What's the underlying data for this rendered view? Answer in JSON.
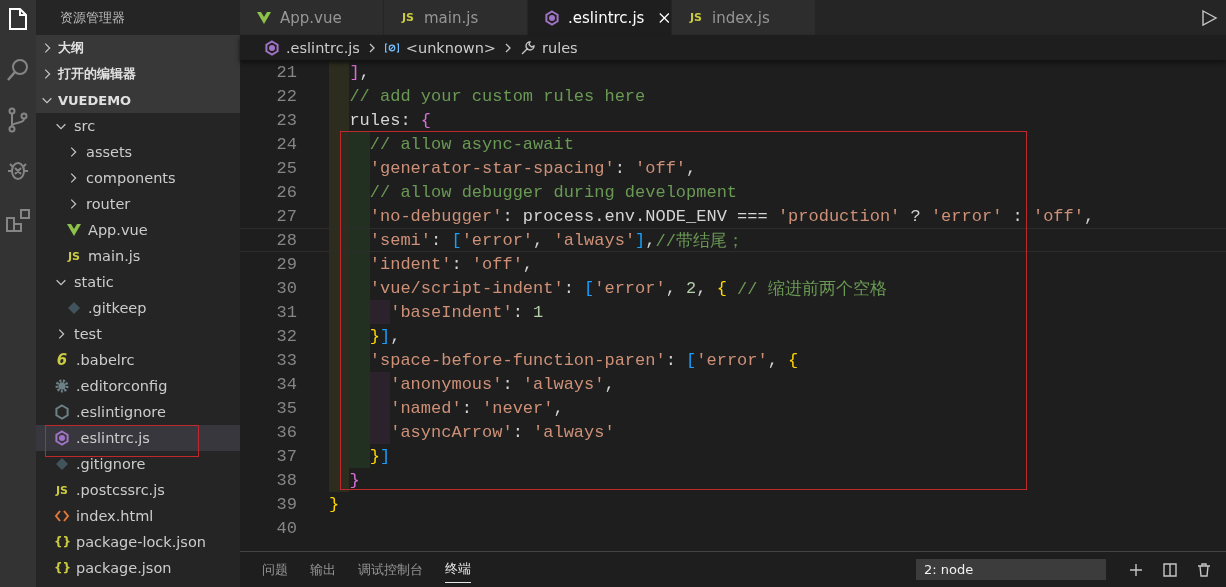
{
  "activity_bar": [
    {
      "kind": "files",
      "selected": true
    },
    {
      "kind": "search",
      "selected": false
    },
    {
      "kind": "scm",
      "selected": false
    },
    {
      "kind": "debug",
      "selected": false
    },
    {
      "kind": "extensions",
      "selected": false
    }
  ],
  "sidebar": {
    "title": "资源管理器",
    "sections": [
      {
        "label": "大纲",
        "expanded": false
      },
      {
        "label": "打开的编辑器",
        "expanded": false
      },
      {
        "label": "VUEDEMO",
        "expanded": true,
        "children": [
          {
            "label": "src",
            "kind": "folder",
            "expanded": true,
            "selected": false,
            "children": [
              {
                "label": "assets",
                "kind": "folder",
                "expanded": false,
                "selected": false
              },
              {
                "label": "components",
                "kind": "folder",
                "expanded": false,
                "selected": false
              },
              {
                "label": "router",
                "kind": "folder",
                "expanded": false,
                "selected": false
              },
              {
                "label": "App.vue",
                "kind": "vue",
                "selected": false
              },
              {
                "label": "main.js",
                "kind": "js",
                "icon_label": "JS",
                "selected": false
              }
            ]
          },
          {
            "label": "static",
            "kind": "folder",
            "expanded": true,
            "selected": false,
            "children": [
              {
                "label": ".gitkeep",
                "kind": "git",
                "selected": false
              }
            ]
          },
          {
            "label": "test",
            "kind": "folder",
            "expanded": false,
            "selected": false
          },
          {
            "label": ".babelrc",
            "kind": "babel",
            "icon_label": "6",
            "selected": false
          },
          {
            "label": ".editorconfig",
            "kind": "gear",
            "selected": false
          },
          {
            "label": ".eslintignore",
            "kind": "eslintignore",
            "selected": false
          },
          {
            "label": ".eslintrc.js",
            "kind": "eslint",
            "selected": true
          },
          {
            "label": ".gitignore",
            "kind": "git",
            "selected": false
          },
          {
            "label": ".postcssrc.js",
            "kind": "js",
            "icon_label": "JS",
            "selected": false
          },
          {
            "label": "index.html",
            "kind": "html",
            "selected": false
          },
          {
            "label": "package-lock.json",
            "kind": "json",
            "icon_label": "{}",
            "selected": false
          },
          {
            "label": "package.json",
            "kind": "json",
            "icon_label": "{}",
            "selected": false
          }
        ]
      }
    ]
  },
  "tabs": [
    {
      "label": "App.vue",
      "kind": "vue",
      "selected": false
    },
    {
      "label": "main.js",
      "kind": "js",
      "icon_label": "JS",
      "selected": false
    },
    {
      "label": ".eslintrc.js",
      "kind": "eslint",
      "selected": true
    },
    {
      "label": "index.js",
      "kind": "js",
      "icon_label": "JS",
      "selected": false
    }
  ],
  "breadcrumb": [
    {
      "label": ".eslintrc.js",
      "kind": "eslint"
    },
    {
      "label": "<unknown>",
      "kind": "variable"
    },
    {
      "label": "rules",
      "kind": "wrench"
    }
  ],
  "code_lines": [
    {
      "number": "21",
      "current": false,
      "tokens": [
        {
          "kind": "bracket2",
          "text": "  ]"
        },
        {
          "kind": "plain",
          "text": ","
        }
      ]
    },
    {
      "number": "22",
      "current": false,
      "tokens": [
        {
          "kind": "comment",
          "text": "  // add your custom rules here"
        }
      ]
    },
    {
      "number": "23",
      "current": false,
      "tokens": [
        {
          "kind": "plain",
          "text": "  rules: "
        },
        {
          "kind": "bracket2",
          "text": "{"
        }
      ]
    },
    {
      "number": "24",
      "current": false,
      "tokens": [
        {
          "kind": "comment",
          "text": "    // allow async-await"
        }
      ]
    },
    {
      "number": "25",
      "current": false,
      "tokens": [
        {
          "kind": "string",
          "text": "    'generator-star-spacing'"
        },
        {
          "kind": "plain",
          "text": ": "
        },
        {
          "kind": "string",
          "text": "'off'"
        },
        {
          "kind": "plain",
          "text": ","
        }
      ]
    },
    {
      "number": "26",
      "current": false,
      "tokens": [
        {
          "kind": "comment",
          "text": "    // allow debugger during development"
        }
      ]
    },
    {
      "number": "27",
      "current": false,
      "tokens": [
        {
          "kind": "string",
          "text": "    'no-debugger'"
        },
        {
          "kind": "plain",
          "text": ": process.env.NODE_ENV === "
        },
        {
          "kind": "string",
          "text": "'production'"
        },
        {
          "kind": "plain",
          "text": " ? "
        },
        {
          "kind": "string",
          "text": "'error'"
        },
        {
          "kind": "plain",
          "text": " : "
        },
        {
          "kind": "string",
          "text": "'off'"
        },
        {
          "kind": "plain",
          "text": ","
        }
      ]
    },
    {
      "number": "28",
      "current": true,
      "tokens": [
        {
          "kind": "string",
          "text": "    'semi'"
        },
        {
          "kind": "plain",
          "text": ": "
        },
        {
          "kind": "bracket3",
          "text": "["
        },
        {
          "kind": "string",
          "text": "'error'"
        },
        {
          "kind": "plain",
          "text": ", "
        },
        {
          "kind": "string",
          "text": "'always'"
        },
        {
          "kind": "bracket3",
          "text": "]"
        },
        {
          "kind": "plain",
          "text": ","
        },
        {
          "kind": "comment",
          "text": "//带结尾；"
        }
      ]
    },
    {
      "number": "29",
      "current": false,
      "tokens": [
        {
          "kind": "string",
          "text": "    'indent'"
        },
        {
          "kind": "plain",
          "text": ": "
        },
        {
          "kind": "string",
          "text": "'off'"
        },
        {
          "kind": "plain",
          "text": ","
        }
      ]
    },
    {
      "number": "30",
      "current": false,
      "tokens": [
        {
          "kind": "string",
          "text": "    'vue/script-indent'"
        },
        {
          "kind": "plain",
          "text": ": "
        },
        {
          "kind": "bracket3",
          "text": "["
        },
        {
          "kind": "string",
          "text": "'error'"
        },
        {
          "kind": "plain",
          "text": ", "
        },
        {
          "kind": "number",
          "text": "2"
        },
        {
          "kind": "plain",
          "text": ", "
        },
        {
          "kind": "bracket1",
          "text": "{"
        },
        {
          "kind": "comment",
          "text": " // 缩进前两个空格"
        }
      ]
    },
    {
      "number": "31",
      "current": false,
      "tokens": [
        {
          "kind": "string",
          "text": "      'baseIndent'"
        },
        {
          "kind": "plain",
          "text": ": "
        },
        {
          "kind": "number",
          "text": "1"
        }
      ]
    },
    {
      "number": "32",
      "current": false,
      "tokens": [
        {
          "kind": "bracket1",
          "text": "    }"
        },
        {
          "kind": "bracket3",
          "text": "]"
        },
        {
          "kind": "plain",
          "text": ","
        }
      ]
    },
    {
      "number": "33",
      "current": false,
      "tokens": [
        {
          "kind": "string",
          "text": "    'space-before-function-paren'"
        },
        {
          "kind": "plain",
          "text": ": "
        },
        {
          "kind": "bracket3",
          "text": "["
        },
        {
          "kind": "string",
          "text": "'error'"
        },
        {
          "kind": "plain",
          "text": ", "
        },
        {
          "kind": "bracket1",
          "text": "{"
        }
      ]
    },
    {
      "number": "34",
      "current": false,
      "tokens": [
        {
          "kind": "string",
          "text": "      'anonymous'"
        },
        {
          "kind": "plain",
          "text": ": "
        },
        {
          "kind": "string",
          "text": "'always'"
        },
        {
          "kind": "plain",
          "text": ","
        }
      ]
    },
    {
      "number": "35",
      "current": false,
      "tokens": [
        {
          "kind": "string",
          "text": "      'named'"
        },
        {
          "kind": "plain",
          "text": ": "
        },
        {
          "kind": "string",
          "text": "'never'"
        },
        {
          "kind": "plain",
          "text": ","
        }
      ]
    },
    {
      "number": "36",
      "current": false,
      "tokens": [
        {
          "kind": "string",
          "text": "      'asyncArrow'"
        },
        {
          "kind": "plain",
          "text": ": "
        },
        {
          "kind": "string",
          "text": "'always'"
        }
      ]
    },
    {
      "number": "37",
      "current": false,
      "tokens": [
        {
          "kind": "bracket1",
          "text": "    }"
        },
        {
          "kind": "bracket3",
          "text": "]"
        }
      ]
    },
    {
      "number": "38",
      "current": false,
      "tokens": [
        {
          "kind": "bracket2",
          "text": "  }"
        }
      ]
    },
    {
      "number": "39",
      "current": false,
      "tokens": [
        {
          "kind": "bracket1",
          "text": "}"
        }
      ]
    },
    {
      "number": "40",
      "current": false
    }
  ],
  "panel": {
    "tabs": [
      {
        "label": "问题",
        "selected": false
      },
      {
        "label": "输出",
        "selected": false
      },
      {
        "label": "调试控制台",
        "selected": false
      },
      {
        "label": "终端",
        "selected": true
      }
    ],
    "terminal_select": "2: node"
  }
}
